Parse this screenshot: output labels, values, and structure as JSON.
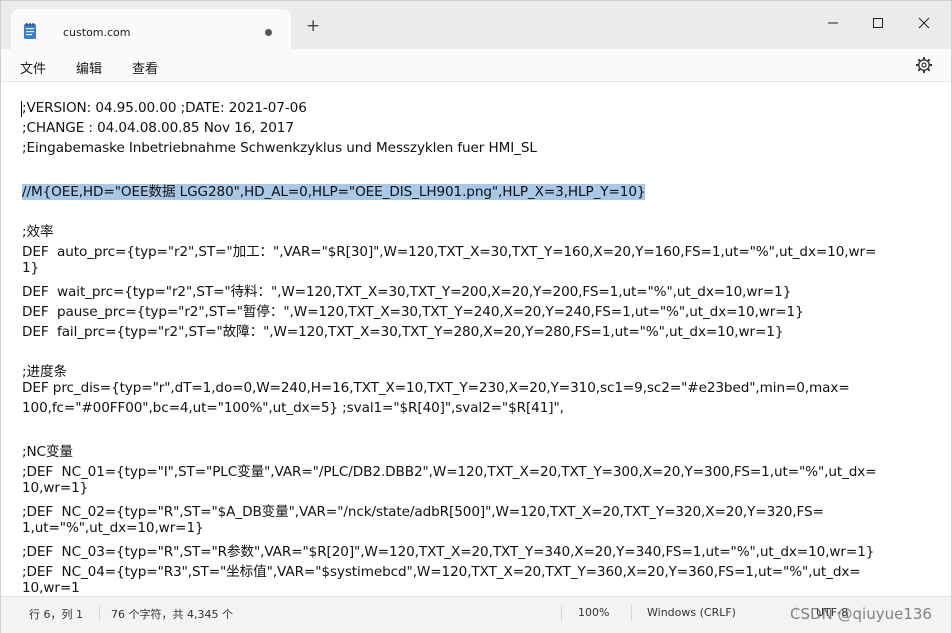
{
  "tab": {
    "title": "custom.com",
    "new_tab_label": "+"
  },
  "menu": {
    "file": "文件",
    "edit": "编辑",
    "view": "查看"
  },
  "editor": {
    "lines": [
      ";VERSION: 04.95.00.00 ;DATE: 2021-07-06",
      ";CHANGE : 04.04.08.00.85 Nov 16, 2017",
      ";Eingabemaske Inbetriebnahme Schwenkzyklus und Messzyklen fuer HMI_SL",
      "",
      "//M{OEE,HD=\"OEE数据 LGG280\",HD_AL=0,HLP=\"OEE_DIS_LH901.png\",HLP_X=3,HLP_Y=10}",
      "",
      ";效率",
      "DEF  auto_prc={typ=\"r2\",ST=\"加工：\",VAR=\"$R[30]\",W=120,TXT_X=30,TXT_Y=160,X=20,Y=160,FS=1,ut=\"%\",ut_dx=10,wr=",
      "1}",
      "DEF  wait_prc={typ=\"r2\",ST=\"待料：\",W=120,TXT_X=30,TXT_Y=200,X=20,Y=200,FS=1,ut=\"%\",ut_dx=10,wr=1}",
      "DEF  pause_prc={typ=\"r2\",ST=\"暂停：\",W=120,TXT_X=30,TXT_Y=240,X=20,Y=240,FS=1,ut=\"%\",ut_dx=10,wr=1}",
      "DEF  fail_prc={typ=\"r2\",ST=\"故障：\",W=120,TXT_X=30,TXT_Y=280,X=20,Y=280,FS=1,ut=\"%\",ut_dx=10,wr=1}",
      "",
      ";进度条",
      "DEF prc_dis={typ=\"r\",dT=1,do=0,W=240,H=16,TXT_X=10,TXT_Y=230,X=20,Y=310,sc1=9,sc2=\"#e23bed\",min=0,max=",
      "100,fc=\"#00FF00\",bc=4,ut=\"100%\",ut_dx=5} ;sval1=\"$R[40]\",sval2=\"$R[41]\",",
      "",
      ";NC变量",
      ";DEF  NC_01={typ=\"I\",ST=\"PLC变量\",VAR=\"/PLC/DB2.DBB2\",W=120,TXT_X=20,TXT_Y=300,X=20,Y=300,FS=1,ut=\"%\",ut_dx=",
      "10,wr=1}",
      ";DEF  NC_02={typ=\"R\",ST=\"$A_DB变量\",VAR=\"/nck/state/adbR[500]\",W=120,TXT_X=20,TXT_Y=320,X=20,Y=320,FS=",
      "1,ut=\"%\",ut_dx=10,wr=1}",
      ";DEF  NC_03={typ=\"R\",ST=\"R参数\",VAR=\"$R[20]\",W=120,TXT_X=20,TXT_Y=340,X=20,Y=340,FS=1,ut=\"%\",ut_dx=10,wr=1}",
      ";DEF  NC_04={typ=\"R3\",ST=\"坐标值\",VAR=\"$systimebcd\",W=120,TXT_X=20,TXT_Y=360,X=20,Y=360,FS=1,ut=\"%\",ut_dx=",
      "10,wr=1"
    ],
    "highlighted_line_index": 4
  },
  "status": {
    "position": "行 6，列 1",
    "chars": "76 个字符，共 4,345 个",
    "zoom": "100%",
    "line_ending": "Windows (CRLF)",
    "encoding": "UTF-8"
  },
  "watermark": "CSDN @qiuyue136"
}
